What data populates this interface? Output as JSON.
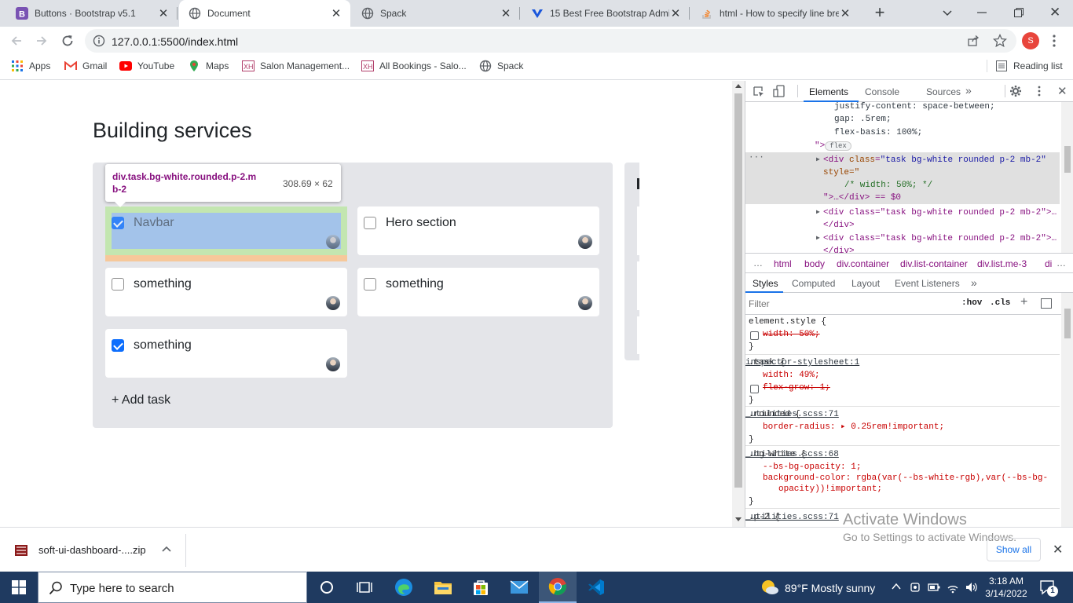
{
  "tabs": [
    {
      "title": "Buttons · Bootstrap v5.1",
      "icon": "bootstrap-icon"
    },
    {
      "title": "Document",
      "icon": "globe-icon",
      "active": true
    },
    {
      "title": "Spack",
      "icon": "globe-icon"
    },
    {
      "title": "15 Best Free Bootstrap Admi",
      "icon": "admin-template-icon"
    },
    {
      "title": "html - How to specify line bre",
      "icon": "stackoverflow-icon"
    }
  ],
  "toolbar": {
    "url": "127.0.0.1:5500/index.html",
    "profile_initial": "S"
  },
  "bookmarks": [
    {
      "label": "Apps"
    },
    {
      "label": "Gmail"
    },
    {
      "label": "YouTube"
    },
    {
      "label": "Maps"
    },
    {
      "label": "Salon Management..."
    },
    {
      "label": "All Bookings - Salo..."
    },
    {
      "label": "Spack"
    }
  ],
  "reading_list": "Reading list",
  "page": {
    "title": "Building services",
    "tooltip": {
      "selector": "div.task.bg-white.rounded.p-2.m",
      "selector2": "b-2",
      "size": "308.69 × 62"
    },
    "tasks": [
      {
        "label": "Navbar",
        "checked": true
      },
      {
        "label": "Hero section",
        "checked": false
      },
      {
        "label": "something",
        "checked": false
      },
      {
        "label": "something",
        "checked": false
      },
      {
        "label": "something",
        "checked": true
      }
    ],
    "add_task": "+ Add task"
  },
  "devtools": {
    "tabs": [
      "Elements",
      "Console",
      "Sources"
    ],
    "active_tab": "Elements",
    "code": {
      "l1": "justify-content: space-between;",
      "l2": "gap: .5rem;",
      "l3": "flex-basis: 100%;",
      "flex_badge": "flex",
      "sel_open": "<div ",
      "sel_attr": "class",
      "sel_val": "\"task bg-white rounded p-2 mb-2\"",
      "sel_style": "style=\"",
      "sel_comment": "/* width: 50%; */",
      "sel_close": "\">…</div> == $0",
      "row2": "<div class=\"task bg-white rounded p-2 mb-2\">…",
      "row2b": "</div>",
      "row3": "<div class=\"task bg-white rounded p-2 mb-2\">…",
      "row3b": "</div>"
    },
    "breadcrumbs": [
      "html",
      "body",
      "div.container",
      "div.list-container",
      "div.list.me-3",
      "di"
    ],
    "style_tabs": [
      "Styles",
      "Computed",
      "Layout",
      "Event Listeners"
    ],
    "filter_placeholder": "Filter",
    "hov": ":hov",
    "cls": ".cls",
    "rules": {
      "r1_sel": "element.style {",
      "r1_p": "width: 50%;",
      "r2_sel": ".task {",
      "r2_src": "inspector-stylesheet:1",
      "r2_p1": "width: 49%;",
      "r2_p2": "flex-grow: 1;",
      "r3_sel": ".rounded {",
      "r3_src": "_utilities.scss:71",
      "r3_p1": "border-radius: ▸ 0.25rem!important;",
      "r4_sel": ".bg-white {",
      "r4_src": "_utilities.scss:68",
      "r4_p1": "--bs-bg-opacity: 1;",
      "r4_p2": "background-color: rgba(var(--bs-white-rgb),var(--bs-bg-",
      "r4_p3": "opacity))!important;",
      "r5_sel": ".p-2 {",
      "r5_src": "_utilities.scss:71",
      "close": "}"
    },
    "activate_title": "Activate Windows",
    "activate_sub": "Go to Settings to activate Windows."
  },
  "download": {
    "filename": "soft-ui-dashboard-....zip",
    "show_all": "Show all"
  },
  "taskbar": {
    "search_placeholder": "Type here to search",
    "weather": "89°F  Mostly sunny",
    "time": "3:18 AM",
    "date": "3/14/2022",
    "notification_count": "1"
  }
}
